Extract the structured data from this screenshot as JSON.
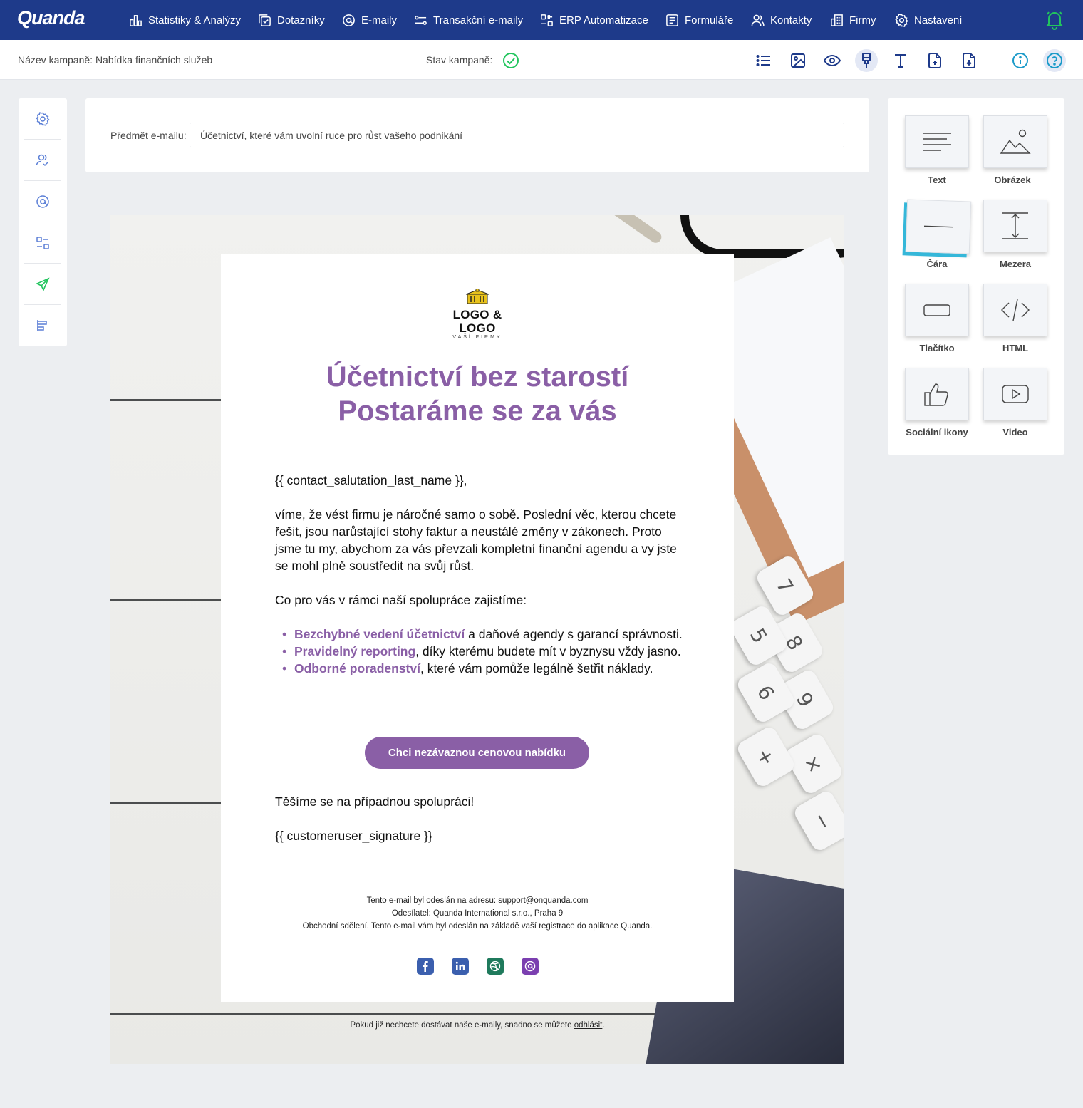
{
  "brand": "Quanda",
  "nav": [
    {
      "label": "Statistiky & Analýzy",
      "icon": "chart-bars-icon"
    },
    {
      "label": "Dotazníky",
      "icon": "survey-icon"
    },
    {
      "label": "E-maily",
      "icon": "at-icon"
    },
    {
      "label": "Transakční e-maily",
      "icon": "transaction-icon"
    },
    {
      "label": "ERP Automatizace",
      "icon": "automation-icon"
    },
    {
      "label": "Formuláře",
      "icon": "form-icon"
    },
    {
      "label": "Kontakty",
      "icon": "contacts-icon"
    },
    {
      "label": "Firmy",
      "icon": "company-icon"
    },
    {
      "label": "Nastavení",
      "icon": "gear-icon"
    }
  ],
  "campaign": {
    "name_label": "Název kampaně: Nabídka finančních služeb",
    "state_label": "Stav kampaně:",
    "state_color": "#22c55e"
  },
  "toolbar": [
    "list-icon",
    "image-icon",
    "eye-icon",
    "brush-icon",
    "text-icon",
    "file-add-icon",
    "download-icon",
    "info-icon",
    "help-icon"
  ],
  "subject": {
    "label": "Předmět e-mailu:",
    "value": "Účetnictví, které vám uvolní ruce pro růst vašeho podnikání"
  },
  "email": {
    "logo_title": "LOGO & LOGO",
    "logo_sub": "VAŠÍ FIRMY",
    "headline_1": "Účetnictví bez starostí",
    "headline_2": "Postaráme se za vás",
    "salutation": "{{ contact_salutation_last_name }},",
    "paragraph": "víme, že vést firmu je náročné samo o sobě. Poslední věc, kterou chcete řešit, jsou narůstající stohy faktur a neustálé změny v zákonech. Proto jsme tu my, abychom za vás převzali kompletní finanční agendu a vy jste se mohl plně soustředit na svůj růst.",
    "intro_list": "Co pro vás v rámci naší spolupráce zajistíme:",
    "bullets": [
      {
        "highlight": "Bezchybné vedení účetnictví",
        "rest": " a daňové agendy s garancí správnosti."
      },
      {
        "highlight": "Pravidelný reporting",
        "rest": ", díky kterému budete mít v byznysu vždy jasno."
      },
      {
        "highlight": "Odborné poradenství",
        "rest": ", které vám pomůže legálně šetřit náklady."
      }
    ],
    "cta": "Chci nezávaznou cenovou nabídku",
    "closing": "Těšíme se na případnou spolupráci!",
    "signature": "{{ customeruser_signature }}",
    "footer_1": "Tento e-mail byl odeslán na adresu: support@onquanda.com",
    "footer_2": "Odesílatel: Quanda International s.r.o., Praha 9",
    "footer_3": "Obchodní sdělení. Tento e-mail vám byl odeslán na základě vaší registrace do aplikace Quanda.",
    "social": [
      {
        "icon": "facebook-icon",
        "color": "#3b5fae"
      },
      {
        "icon": "linkedin-icon",
        "color": "#3b5fae"
      },
      {
        "icon": "dribbble-icon",
        "color": "#1f7a5c"
      },
      {
        "icon": "email-at-icon",
        "color": "#7b3fb0"
      }
    ],
    "unsub_text": "Pokud již nechcete dostávat naše e-maily, snadno se můžete ",
    "unsub_link": "odhlásit",
    "unsub_end": ".",
    "accent": "#8a5fa6"
  },
  "palette": [
    {
      "label": "Text",
      "icon": "text-lines-icon"
    },
    {
      "label": "Obrázek",
      "icon": "image-mountain-icon"
    },
    {
      "label": "Čára",
      "icon": "line-icon"
    },
    {
      "label": "Mezera",
      "icon": "spacer-icon"
    },
    {
      "label": "Tlačítko",
      "icon": "button-shape-icon"
    },
    {
      "label": "HTML",
      "icon": "code-icon"
    },
    {
      "label": "Sociální ikony",
      "icon": "thumbs-up-icon"
    },
    {
      "label": "Video",
      "icon": "video-play-icon"
    }
  ],
  "colors": {
    "nav_bg": "#1e3a8a",
    "bell": "#22c55e",
    "sidebar_icon": "#5b7fd6",
    "send_icon": "#22c55e"
  }
}
